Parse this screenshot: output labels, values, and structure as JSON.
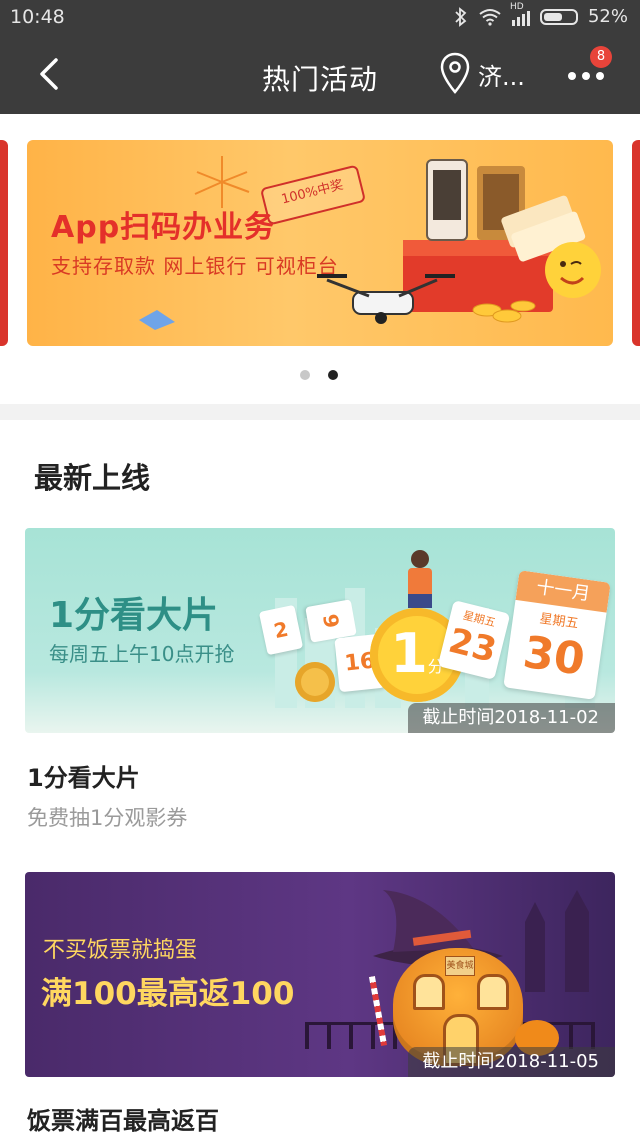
{
  "status_bar": {
    "time": "10:48",
    "battery": "52%",
    "signal_label": "HD",
    "icons": [
      "bluetooth-icon",
      "wifi-icon",
      "signal-icon",
      "battery-icon"
    ]
  },
  "header": {
    "title": "热门活动",
    "location": "济...",
    "notification_count": "8",
    "icons": [
      "back-arrow-icon",
      "location-pin-icon",
      "more-dots-icon"
    ]
  },
  "carousel": {
    "banner_title": "App扫码办业务",
    "banner_subtitle": "支持存取款 网上银行 可视柜台",
    "stamp_text": "100%中奖",
    "page_count": 2,
    "active_page": 2
  },
  "section": {
    "title": "最新上线"
  },
  "activities": [
    {
      "banner_headline": "1分看大片",
      "banner_subline": "每周五上午10点开抢",
      "deadline": "截止时间2018-11-02",
      "title": "1分看大片",
      "subtitle": "免费抽1分观影券",
      "calendar": {
        "month": "十一月",
        "weekday": "星期五",
        "days": [
          "2",
          "9",
          "16",
          "23",
          "30"
        ],
        "coin_label": "1",
        "coin_unit": "分"
      }
    },
    {
      "banner_line1": "不买饭票就捣蛋",
      "banner_line2": "满100最高返100",
      "deadline": "截止时间2018-11-05",
      "title": "饭票满百最高返百",
      "sign_text": "美食城"
    }
  ],
  "colors": {
    "bar": "#3c3c3c",
    "accent_red": "#e8443a",
    "hero_orange": "#ffb347",
    "teal": "#a7e3d6",
    "purple": "#4a2a6a"
  }
}
